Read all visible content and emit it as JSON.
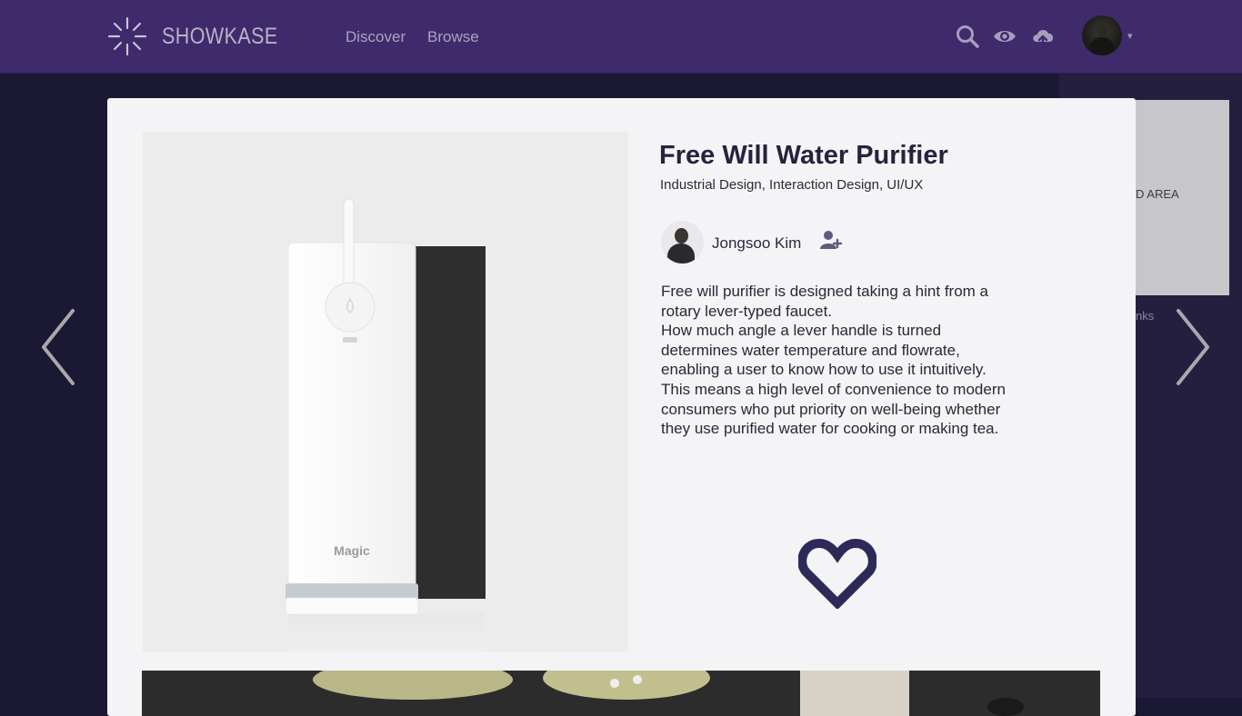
{
  "header": {
    "logo_text": "SHOWKASE",
    "nav": [
      {
        "label": "Discover"
      },
      {
        "label": "Browse"
      }
    ],
    "icons": [
      "search-icon",
      "eye-icon",
      "cloud-upload-icon"
    ],
    "caret": "▾"
  },
  "colors": {
    "header_bg": "#3f2a6b",
    "page_bg": "#1b1833",
    "card_bg": "#f4f3f6",
    "accent": "#2d2a5a"
  },
  "background_panel": {
    "label": "D AREA",
    "link_fragment": "nks"
  },
  "project": {
    "title": "Free Will Water Purifier",
    "categories": "Industrial Design, Interaction Design, UI/UX",
    "author": "Jongsoo Kim",
    "description": "Free will purifier is designed taking a hint from a\nrotary lever-typed faucet.\nHow much angle a lever handle is turned\ndetermines water temperature and flowrate,\nenabling a user to know how to use it intuitively.\nThis means a high level of convenience to modern\nconsumers who put priority on well-being whether\nthey use purified water for cooking or making tea.",
    "product_brand": "Magic"
  }
}
